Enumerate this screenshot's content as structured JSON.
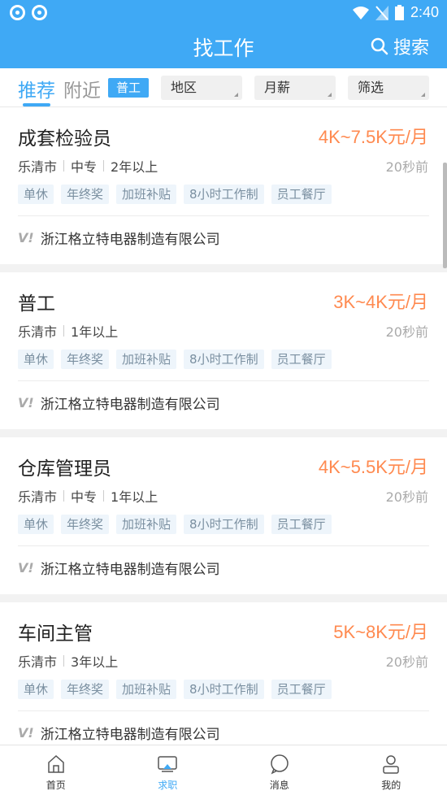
{
  "status_bar": {
    "time": "2:40"
  },
  "header": {
    "title": "找工作",
    "search_label": "搜索"
  },
  "filters": {
    "tabs": [
      {
        "label": "推荐",
        "active": true
      },
      {
        "label": "附近",
        "active": false
      }
    ],
    "active_chip": "普工",
    "dropdowns": [
      {
        "label": "地区"
      },
      {
        "label": "月薪"
      },
      {
        "label": "筛选"
      }
    ]
  },
  "jobs": [
    {
      "title": "成套检验员",
      "salary": "4K~7.5K元/月",
      "meta": [
        "乐清市",
        "中专",
        "2年以上"
      ],
      "time": "20秒前",
      "tags": [
        "单休",
        "年终奖",
        "加班补贴",
        "8小时工作制",
        "员工餐厅"
      ],
      "company": "浙江格立特电器制造有限公司"
    },
    {
      "title": "普工",
      "salary": "3K~4K元/月",
      "meta": [
        "乐清市",
        "1年以上"
      ],
      "time": "20秒前",
      "tags": [
        "单休",
        "年终奖",
        "加班补贴",
        "8小时工作制",
        "员工餐厅"
      ],
      "company": "浙江格立特电器制造有限公司"
    },
    {
      "title": "仓库管理员",
      "salary": "4K~5.5K元/月",
      "meta": [
        "乐清市",
        "中专",
        "1年以上"
      ],
      "time": "20秒前",
      "tags": [
        "单休",
        "年终奖",
        "加班补贴",
        "8小时工作制",
        "员工餐厅"
      ],
      "company": "浙江格立特电器制造有限公司"
    },
    {
      "title": "车间主管",
      "salary": "5K~8K元/月",
      "meta": [
        "乐清市",
        "3年以上"
      ],
      "time": "20秒前",
      "tags": [
        "单休",
        "年终奖",
        "加班补贴",
        "8小时工作制",
        "员工餐厅"
      ],
      "company": "浙江格立特电器制造有限公司"
    }
  ],
  "bottom_nav": [
    {
      "label": "首页",
      "icon": "home-icon",
      "active": false
    },
    {
      "label": "求职",
      "icon": "job-search-icon",
      "active": true
    },
    {
      "label": "消息",
      "icon": "message-icon",
      "active": false
    },
    {
      "label": "我的",
      "icon": "profile-icon",
      "active": false
    }
  ],
  "colors": {
    "brand": "#3fa9f5",
    "salary": "#ff8a50"
  }
}
